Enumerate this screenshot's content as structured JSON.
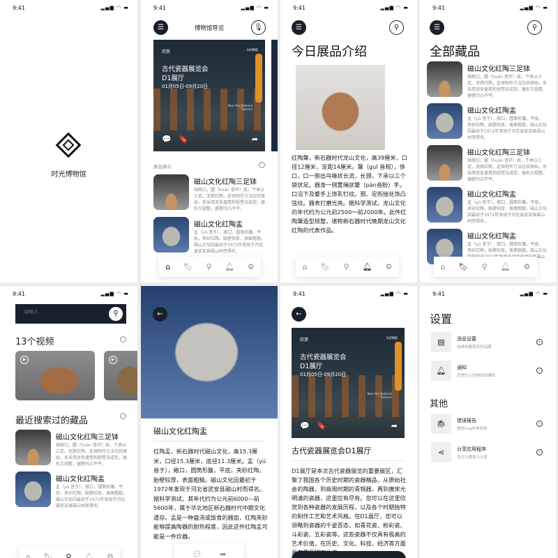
{
  "status_time": "9:41",
  "colors": {
    "primary_dark": "#18202b",
    "accent_gold": "#e2902a"
  },
  "splash": {
    "app_name": "时光博物馆",
    "logo_icon": "diamond-logo"
  },
  "guide": {
    "title": "博物馆导览",
    "card": {
      "tag": "欣赏",
      "time": "3分钟前",
      "title_line1": "古代瓷器展览会",
      "title_line2": "D1展厅",
      "dates": "01月05日-09月20日",
      "watermark": "Near the National Treasure"
    },
    "section_label": "展品展示",
    "items": [
      {
        "title": "磁山文化红陶三足钵",
        "desc": "钵敞口，圜（huán 音环）底，下承以三足。泥质红陶，此钵制作方法比较原始，系采用泥条盘筑和捏塑法成型，器形欠规整，器壁凹凸不平。"
      },
      {
        "title": "磁山文化红陶盂",
        "desc": "盂（yú 音于），敞口，圆筒形腹，平底，夹砂红陶，胎壁较厚，表面粗糙。磁山文化因最初于1972年发现于河北省武安县磁山村而得名。"
      }
    ]
  },
  "today": {
    "title": "今日展品介绍",
    "text": "红陶鬶，新石器时代龙山文化，高39厘米，口径12厘米，足距14厘米。鬶（guī 音规），侈口，口一侧出鸟喙状长流，长颈，下承以三个袋状足。器身一侧置绳状鋬（pàn音盼）手。口沿下及鋬手上饰乳钉纹。颈、足衔接处饰凸弦纹。器表打磨光亮。据科学测试，龙山文化的年代约为公元前2500～前2000年。此件红陶鬶造型规整，堪称新石器时代晚期龙山文化红陶的代表作品。"
  },
  "collection": {
    "title": "全部藏品",
    "items": [
      {
        "title": "磁山文化红陶三足钵",
        "desc": "钵敞口，圜（huán 音环）底，下承以三足。泥质红陶，此钵制作方法比较原始，系采用泥条盘筑和捏塑法成型，器形欠规整，器壁凹凸不平。",
        "img": "bowl"
      },
      {
        "title": "磁山文化红陶盂",
        "desc": "盂（yú 音于），敞口，圆筒形腹，平底，夹砂红陶，胎壁较厚，表面粗糙。磁山文化因最初于1972年发现于河北省武安县磁山村而得名。",
        "img": "cup"
      },
      {
        "title": "磁山文化红陶三足钵",
        "desc": "钵敞口，圜（huán 音环）底，下承以三足。泥质红陶，此钵制作方法比较原始，系采用泥条盘筑和捏塑法成型，器形欠规整，器壁凹凸不平。",
        "img": "bowl"
      },
      {
        "title": "磁山文化红陶盂",
        "desc": "盂（yú 音于），敞口，圆筒形腹，平底，夹砂红陶，胎壁较厚，表面粗糙。磁山文化因最初于1972年发现于河北省武安县磁山村而得名。",
        "img": "cup"
      },
      {
        "title": "磁山文化红陶盂",
        "desc": "盂（yú 音于），敞口，圆筒形腹，平底，夹砂红陶，胎壁较厚，表面粗糙。磁山文化因最初于1972年发现于河北省武安县磁山村而得名。",
        "img": "cup"
      }
    ]
  },
  "search": {
    "placeholder": "请输入",
    "videos_title": "13个视频",
    "recent_title": "最近搜索过的藏品",
    "items": [
      {
        "title": "磁山文化红陶三足钵",
        "desc": "钵敞口，圜（huán 音环）底，下承以三足。泥质红陶，此钵制作方法比较原始，系采用泥条盘筑和捏塑法成型，器形欠规整，器壁凹凸不平。"
      },
      {
        "title": "磁山文化红陶盂",
        "desc": "盂（yú 音于），敞口，圆筒形腹，平底，夹砂红陶，胎壁较厚，表面粗糙。磁山文化因最初于1972年发现于河北省武安县磁山村而得名。"
      }
    ]
  },
  "detail": {
    "title": "磁山文化红陶盂",
    "text": "红陶盂，新石器时代磁山文化，高15.3厘米，口径15.3厘米，底径11.3厘米。盂（yú 音于），敞口，圆筒形腹，平底，夹砂红陶，胎壁较厚，表面粗糙。磁山文化因最初于1972年发现于河北省武安县磁山村而得名。据科学测试，其年代约为公元前6000—前5600年，属于华北地区新石器时代中期文化遗存。盂是一种盛汤或饭食的器皿，红陶夹砂能够提高陶器的耐热程度，因此这件红陶盂可能是一件炊器。"
  },
  "hall": {
    "title": "古代瓷器展览会D1展厅",
    "text": "D1展厅是本次古代瓷器展览的重要展区，汇聚了我国各个历史时期的瓷器精品，从原始社会的陶器，到商周时期的青铜器，再到唐宋元明清的瓷器，这里应有尽有。您可以在这里欣赏到各种瓷器的发展历程，以及各个时期独特的制作工艺和艺术风格。在D1展厅，您可以领略到瓷器的千姿百态，如青花瓷、粉彩瓷、斗彩瓷、五彩瓷等。这些瓷器不仅具有极高的艺术价值，在历史、文化、科技、经济等方面具有重要研究价值。"
  },
  "settings": {
    "title": "设置",
    "other_title": "其他",
    "items": [
      {
        "title": "消息设置",
        "sub": "选择你最喜欢的话题",
        "icon": "message-icon"
      },
      {
        "title": "通知",
        "sub": "您想什么时候收到通知",
        "icon": "bell-icon"
      }
    ],
    "other_items": [
      {
        "title": "错误报告",
        "sub": "报告bug非常容易",
        "icon": "bug-icon"
      },
      {
        "title": "分享应用程序",
        "sub": "在社交媒体上分享",
        "icon": "share-icon"
      }
    ]
  }
}
